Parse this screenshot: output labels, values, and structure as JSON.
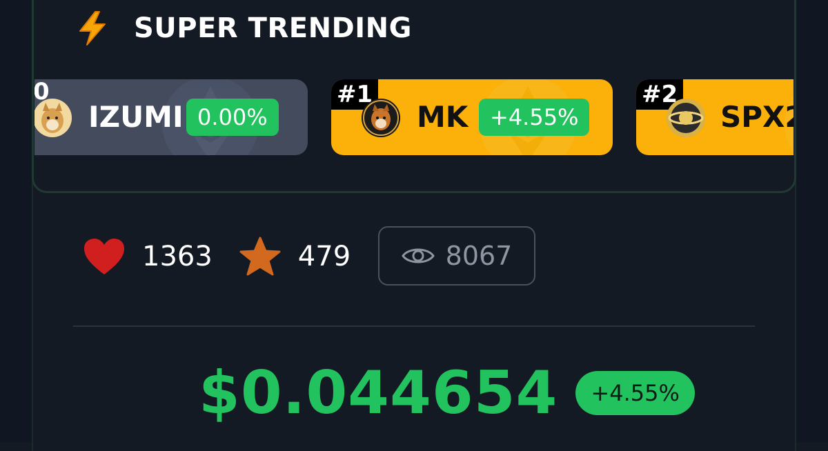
{
  "header": {
    "title": "SUPER TRENDING",
    "icon": "lightning-bolt-icon"
  },
  "trending_cards": [
    {
      "rank": "0",
      "name": "IZUMI",
      "change": "0.00%",
      "bg": "#434b5d"
    },
    {
      "rank": "#1",
      "name": "MK",
      "change": "+4.55%",
      "bg": "#fbb10a"
    },
    {
      "rank": "#2",
      "name": "SPX2",
      "change": "",
      "bg": "#fbb10a"
    }
  ],
  "stats": {
    "likes": "1363",
    "stars": "479",
    "views": "8067"
  },
  "price": {
    "value": "$0.044654",
    "change": "+4.55%"
  },
  "colors": {
    "background": "#141a24",
    "accent_green": "#22c35e",
    "heart": "#d11f1f",
    "star": "#d2691e",
    "card_gold": "#fbb10a"
  }
}
